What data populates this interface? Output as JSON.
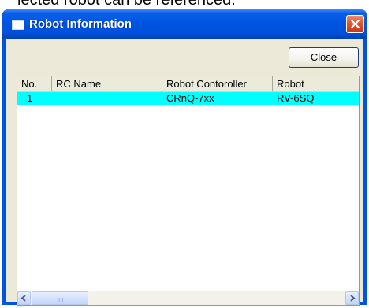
{
  "caption": "lected robot can be referenced.",
  "window": {
    "title": "Robot Information",
    "close_button": "Close"
  },
  "table": {
    "columns": [
      "No.",
      "RC Name",
      "Robot Contoroller",
      "Robot"
    ],
    "rows": [
      {
        "no": "1",
        "rc_name": "",
        "controller": "CRnQ-7xx",
        "robot": "RV-6SQ"
      }
    ],
    "selected_row_color": "#00ffff"
  },
  "scrollbar": {
    "grip": "III"
  }
}
